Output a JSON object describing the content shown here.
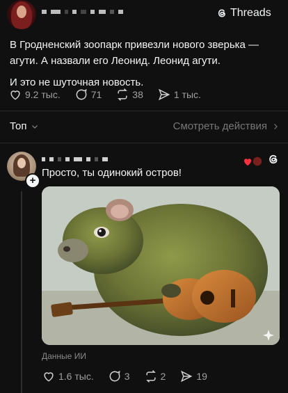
{
  "top_post": {
    "lines": [
      "В Гродненский зоопарк привезли нового зверька —",
      "агути. А назвали его Леонид. Леонид агути."
    ],
    "line2": "И это не шуточная новость.",
    "likes": "9.2 тыс.",
    "comments": "71",
    "reposts": "38",
    "shares": "1 тыс."
  },
  "brand": {
    "name": "Threads"
  },
  "sort": {
    "label": "Топ",
    "actions_link": "Смотреть действия"
  },
  "reply": {
    "text": "Просто, ты одинокий остров!",
    "ai_label": "Данные ИИ",
    "likes": "1.6 тыс.",
    "comments": "3",
    "reposts": "2",
    "shares": "19"
  },
  "colors": {
    "background": "#101010",
    "text": "#f3f5f7",
    "muted": "#a0a0a0",
    "like_red": "#ff3040"
  }
}
